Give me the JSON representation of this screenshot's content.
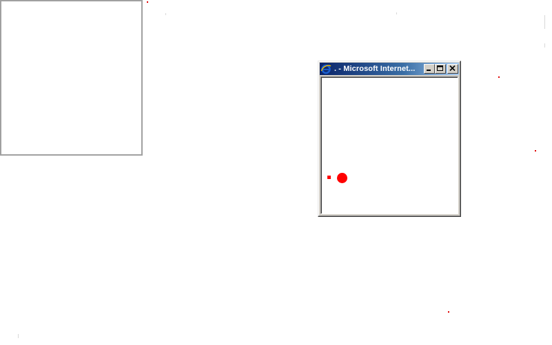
{
  "ie_window": {
    "title": ". - Microsoft Internet...",
    "logo_icon": "internet-explorer-icon",
    "controls": {
      "minimize_icon": "minimize-icon",
      "maximize_icon": "maximize-icon",
      "close_icon": "close-icon"
    }
  },
  "colors": {
    "accent_red": "#ff0000",
    "titlebar_start": "#0a246a",
    "titlebar_end": "#a6caf0",
    "window_face": "#d4d0c8",
    "panel_border": "#a0a0a0"
  }
}
